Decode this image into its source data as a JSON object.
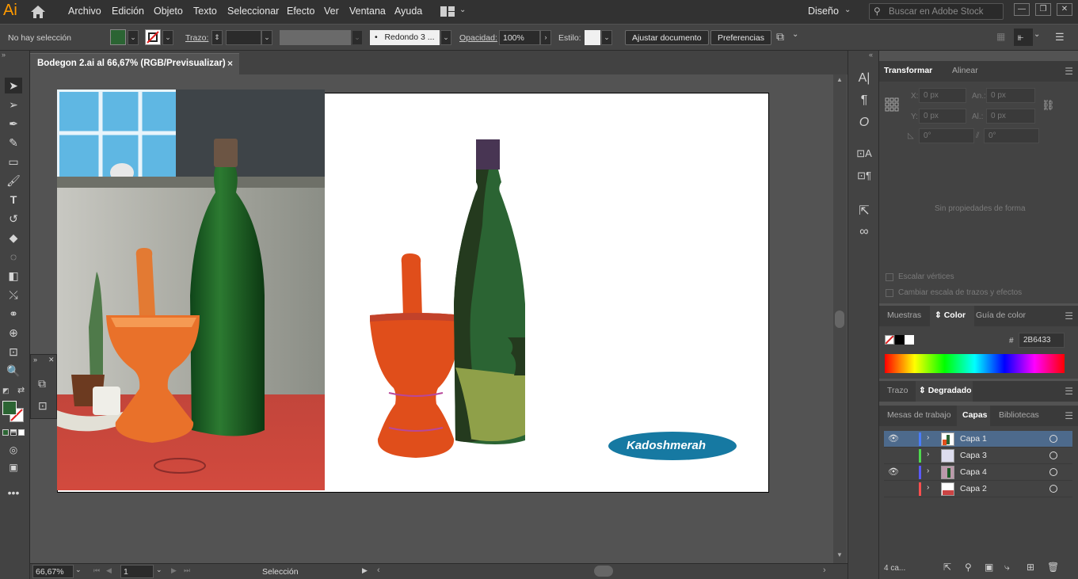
{
  "app": {
    "logo": "Ai",
    "workspace": "Diseño",
    "stock_placeholder": "Buscar en Adobe Stock"
  },
  "menu": [
    "Archivo",
    "Edición",
    "Objeto",
    "Texto",
    "Seleccionar",
    "Efecto",
    "Ver",
    "Ventana",
    "Ayuda"
  ],
  "control": {
    "selection": "No hay selección",
    "stroke_label": "Trazo:",
    "brush": "Redondo 3 ...",
    "opacity_label": "Opacidad:",
    "opacity": "100%",
    "style_label": "Estilo:",
    "fit_button": "Ajustar documento",
    "prefs_button": "Preferencias",
    "fill_color": "#2B6433"
  },
  "document": {
    "tab": "Bodegon 2.ai al 66,67% (RGB/Previsualizar)",
    "close": "×",
    "signature": "Kadoshmerah"
  },
  "status": {
    "zoom": "66,67%",
    "page": "1",
    "tool": "Selección"
  },
  "transform": {
    "tabs": [
      "Transformar",
      "Alinear"
    ],
    "x_label": "X:",
    "y_label": "Y:",
    "w_label": "An.:",
    "h_label": "Al.:",
    "x": "0 px",
    "y": "0 px",
    "w": "0 px",
    "h": "0 px",
    "rot": "0°",
    "shear": "0°",
    "no_props": "Sin propiedades de forma",
    "scale_corners": "Escalar vértices",
    "scale_strokes": "Cambiar escala de trazos y efectos"
  },
  "color": {
    "tabs": [
      "Muestras",
      "Color",
      "Guía de color"
    ],
    "hash": "#",
    "hex": "2B6433"
  },
  "stroke_panel": {
    "tabs": [
      "Trazo",
      "Degradado"
    ]
  },
  "layers": {
    "tabs": [
      "Mesas de trabajo",
      "Capas",
      "Bibliotecas"
    ],
    "items": [
      {
        "name": "Capa 1",
        "color": "#4a7cff",
        "visible": true
      },
      {
        "name": "Capa 3",
        "color": "#4fd84f",
        "visible": false
      },
      {
        "name": "Capa 4",
        "color": "#5a5aff",
        "visible": true
      },
      {
        "name": "Capa 2",
        "color": "#ff4f4f",
        "visible": false
      }
    ],
    "count": "4 ca..."
  }
}
